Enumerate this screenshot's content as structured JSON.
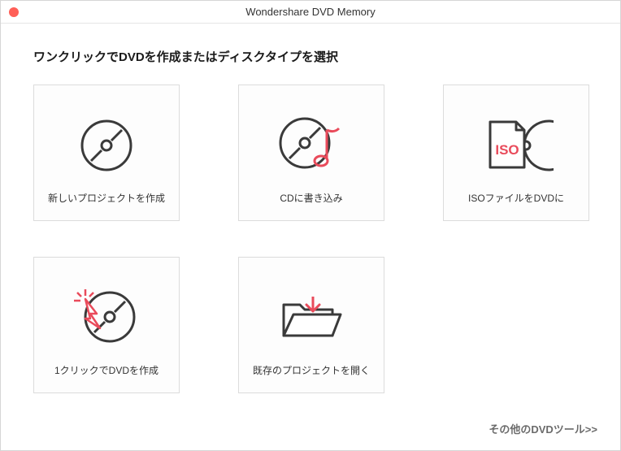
{
  "window": {
    "title": "Wondershare DVD Memory"
  },
  "heading": "ワンクリックでDVDを作成またはディスクタイプを選択",
  "cards": [
    {
      "label": "新しいプロジェクトを作成"
    },
    {
      "label": "CDに書き込み"
    },
    {
      "label": "ISOファイルをDVDに",
      "iso_text": "ISO"
    },
    {
      "label": "1クリックでDVDを作成"
    },
    {
      "label": "既存のプロジェクトを開く"
    }
  ],
  "footer": {
    "more_tools": "その他のDVDツール>>"
  },
  "colors": {
    "accent": "#e94b5b",
    "stroke": "#3a3a3a"
  }
}
